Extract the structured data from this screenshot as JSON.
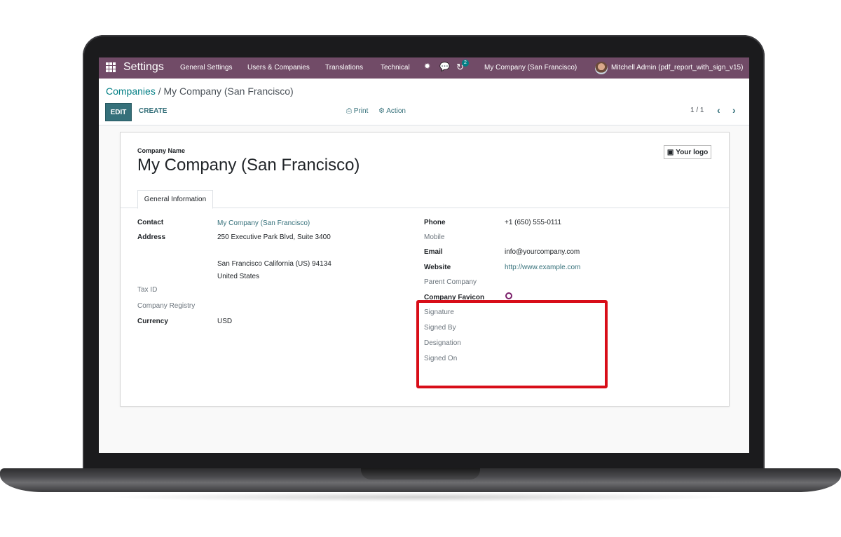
{
  "navbar": {
    "app_title": "Settings",
    "menu": [
      "General Settings",
      "Users & Companies",
      "Translations",
      "Technical"
    ],
    "chat_badge": "2",
    "company_switcher": "My Company (San Francisco)",
    "user": "Mitchell Admin (pdf_report_with_sign_v15)"
  },
  "breadcrumb": {
    "parent": "Companies",
    "separator": " / ",
    "current": "My Company (San Francisco)"
  },
  "toolbar": {
    "edit_label": "EDIT",
    "create_label": "CREATE",
    "print_label": "Print",
    "action_label": "Action",
    "pager": "1 / 1"
  },
  "form": {
    "company_name_label": "Company Name",
    "company_name": "My Company (San Francisco)",
    "logo_button": "Your logo",
    "tab_label": "General Information",
    "left": {
      "contact_label": "Contact",
      "contact_value": "My Company (San Francisco)",
      "address_label": "Address",
      "street": "250 Executive Park Blvd, Suite 3400",
      "city_line": "San Francisco  California (US)  94134",
      "country": "United States",
      "tax_id_label": "Tax ID",
      "registry_label": "Company Registry",
      "currency_label": "Currency",
      "currency_value": "USD"
    },
    "right": {
      "phone_label": "Phone",
      "phone_value": "+1 (650) 555-0111",
      "mobile_label": "Mobile",
      "email_label": "Email",
      "email_value": "info@yourcompany.com",
      "website_label": "Website",
      "website_value": "http://www.example.com",
      "parent_label": "Parent Company",
      "favicon_label": "Company Favicon",
      "signature_label": "Signature",
      "signed_by_label": "Signed By",
      "designation_label": "Designation",
      "signed_on_label": "Signed On"
    }
  },
  "colors": {
    "navbar": "#714b67",
    "primary": "#35707a",
    "highlight": "#d80d18"
  }
}
